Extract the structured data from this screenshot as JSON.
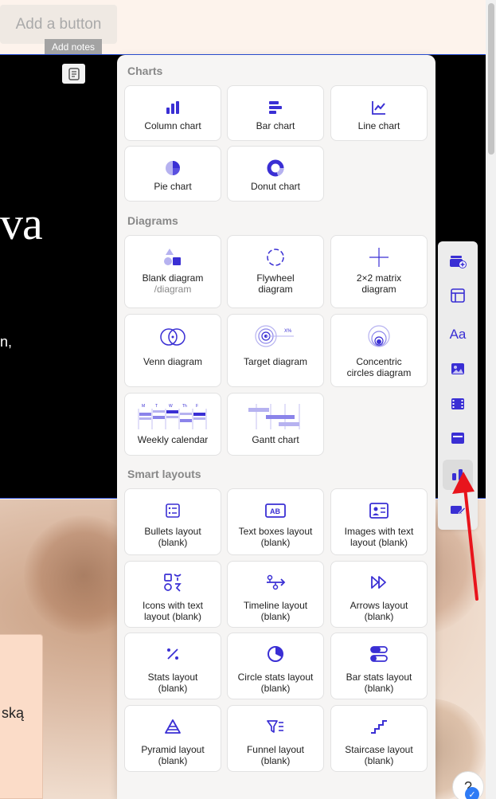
{
  "editor": {
    "add_button_label": "Add a button",
    "add_notes_label": "Add notes",
    "slide_big_text": "va",
    "slide_small_text": "n,",
    "card_text": "ską"
  },
  "panel": {
    "charts_title": "Charts",
    "charts": [
      {
        "label": "Column chart",
        "icon": "column-chart-icon"
      },
      {
        "label": "Bar chart",
        "icon": "bar-chart-icon"
      },
      {
        "label": "Line chart",
        "icon": "line-chart-icon"
      },
      {
        "label": "Pie chart",
        "icon": "pie-chart-icon"
      },
      {
        "label": "Donut chart",
        "icon": "donut-chart-icon"
      }
    ],
    "diagrams_title": "Diagrams",
    "diagrams": [
      {
        "label": "Blank diagram",
        "sub": "/diagram",
        "icon": "shapes-icon"
      },
      {
        "label": "Flywheel diagram",
        "icon": "flywheel-icon"
      },
      {
        "label": "2×2 matrix diagram",
        "icon": "matrix-icon"
      },
      {
        "label": "Venn diagram",
        "icon": "venn-icon"
      },
      {
        "label": "Target diagram",
        "icon": "target-icon"
      },
      {
        "label": "Concentric circles diagram",
        "icon": "concentric-circles-icon"
      },
      {
        "label": "Weekly calendar",
        "icon": "weekly-calendar-icon"
      },
      {
        "label": "Gantt chart",
        "icon": "gantt-icon"
      }
    ],
    "calendar_days": [
      "M",
      "T",
      "W",
      "Th",
      "F"
    ],
    "smart_title": "Smart layouts",
    "smart": [
      {
        "label": "Bullets layout (blank)",
        "icon": "bullets-icon"
      },
      {
        "label": "Text boxes layout (blank)",
        "icon": "text-boxes-icon"
      },
      {
        "label": "Images with text layout (blank)",
        "icon": "images-text-icon"
      },
      {
        "label": "Icons with text layout (blank)",
        "icon": "icons-text-icon"
      },
      {
        "label": "Timeline layout (blank)",
        "icon": "timeline-icon"
      },
      {
        "label": "Arrows layout (blank)",
        "icon": "arrows-icon"
      },
      {
        "label": "Stats layout (blank)",
        "icon": "percent-icon"
      },
      {
        "label": "Circle stats layout (blank)",
        "icon": "circle-stats-icon"
      },
      {
        "label": "Bar stats layout (blank)",
        "icon": "bar-stats-icon"
      },
      {
        "label": "Pyramid layout (blank)",
        "icon": "pyramid-icon"
      },
      {
        "label": "Funnel layout (blank)",
        "icon": "funnel-icon"
      },
      {
        "label": "Staircase layout (blank)",
        "icon": "staircase-icon"
      }
    ]
  },
  "toolbar": {
    "items": [
      "add-card-icon",
      "layout-icon",
      "text-icon",
      "image-icon",
      "video-icon",
      "embed-icon",
      "chart-icon",
      "edit-icon"
    ],
    "active_index": 6,
    "text_icon_glyph": "Aa"
  },
  "help": {
    "glyph": "?",
    "badge": "✓"
  },
  "colors": {
    "accent": "#3a2fd4",
    "accent_light": "#b6b2f0",
    "annotation_arrow": "#e8141c"
  }
}
